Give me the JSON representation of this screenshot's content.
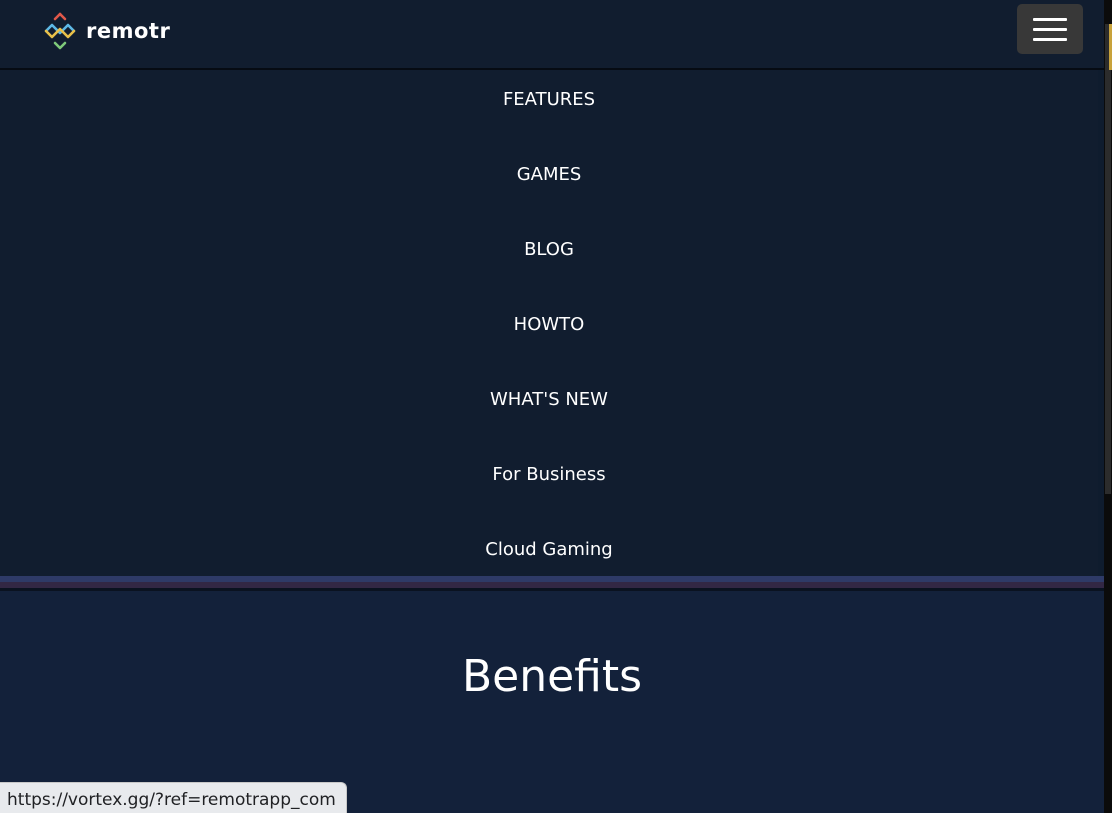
{
  "header": {
    "brand": "remotr",
    "logo_icon": "remotr-logo-icon",
    "menu_icon": "hamburger-icon"
  },
  "nav": {
    "items": [
      {
        "label": "FEATURES"
      },
      {
        "label": "GAMES"
      },
      {
        "label": "BLOG"
      },
      {
        "label": "HOWTO"
      },
      {
        "label": "WHAT'S NEW"
      },
      {
        "label": "For Business"
      },
      {
        "label": "Cloud Gaming"
      }
    ]
  },
  "benefits": {
    "title": "Benefits"
  },
  "status_bar": {
    "url": "https://vortex.gg/?ref=remotrapp_com"
  },
  "colors": {
    "background": "#111d2f",
    "section_background": "#13213a",
    "menu_button": "#383838",
    "divider_purple": "#2e3a67",
    "divider_maroon": "#322744",
    "text": "#ffffff"
  }
}
